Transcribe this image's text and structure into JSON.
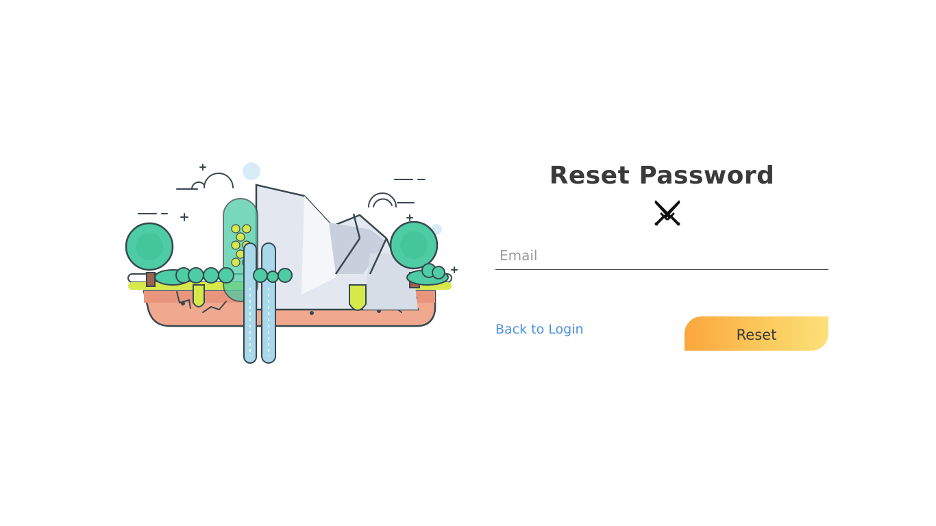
{
  "form": {
    "title": "Reset Password",
    "email_placeholder": "Email",
    "email_value": "",
    "back_link_label": "Back to Login",
    "reset_button_label": "Reset"
  },
  "icons": {
    "header_icon": "crossed-swords-icon",
    "illustration": "floating-island-illustration"
  },
  "colors": {
    "title": "#3a3a3a",
    "link": "#4a90e2",
    "button_gradient_start": "#fba63c",
    "button_gradient_end": "#fde07a"
  }
}
